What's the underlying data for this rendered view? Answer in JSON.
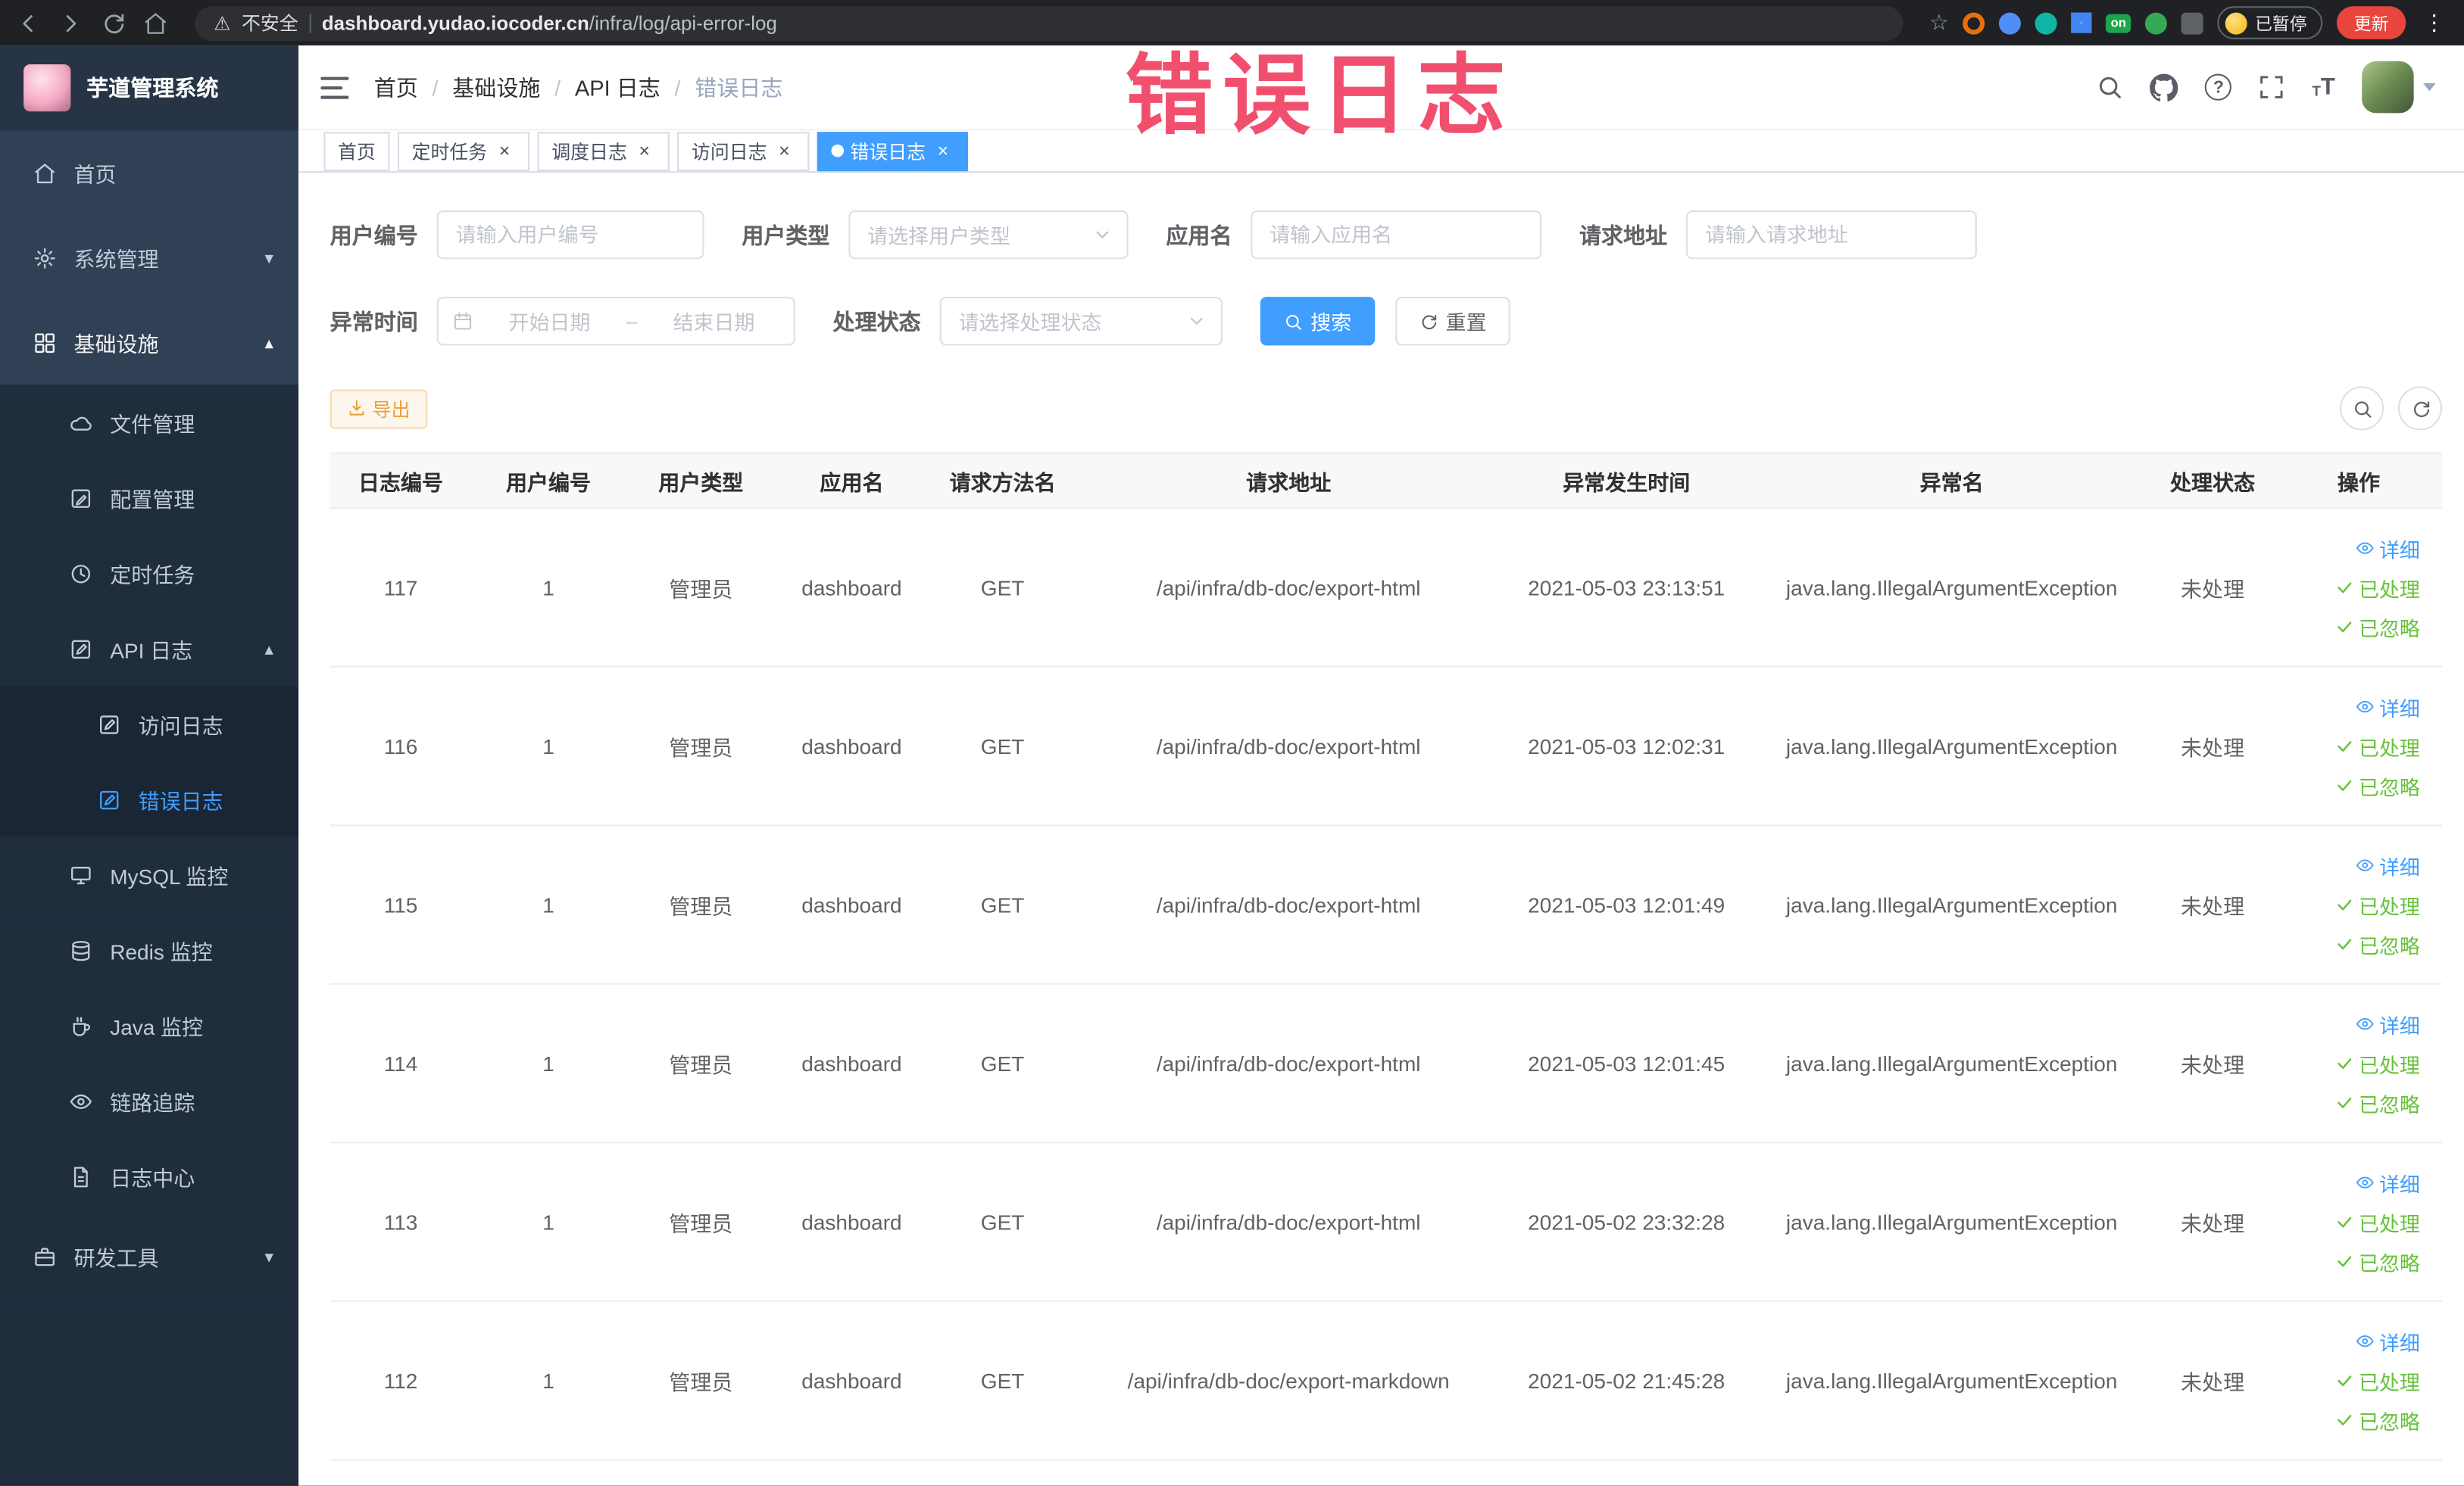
{
  "colors": {
    "accent": "#409EFF",
    "success": "#67C23A",
    "warning": "#E6A23C",
    "overlay": "#F0506E",
    "sidebar_bg": "#304156"
  },
  "overlay_text": "错误日志",
  "browser": {
    "security_label": "不安全",
    "url_domain": "dashboard.yudao.iocoder.cn",
    "url_path": "/infra/log/api-error-log",
    "ext_on_badge": "on",
    "paused_badge": "已暂停",
    "update_button": "更新"
  },
  "app": {
    "logo_title": "芋道管理系统"
  },
  "sidebar": {
    "items": [
      {
        "label": "首页",
        "level": 1,
        "icon": "home-icon"
      },
      {
        "label": "系统管理",
        "level": 1,
        "icon": "gear-icon",
        "arrow": "down"
      },
      {
        "label": "基础设施",
        "level": 1,
        "icon": "grid-icon",
        "arrow": "up",
        "expanded": true
      },
      {
        "label": "文件管理",
        "level": 2,
        "icon": "cloud-icon"
      },
      {
        "label": "配置管理",
        "level": 2,
        "icon": "edit-icon"
      },
      {
        "label": "定时任务",
        "level": 2,
        "icon": "clock-icon"
      },
      {
        "label": "API 日志",
        "level": 2,
        "icon": "log-icon",
        "arrow": "up",
        "expanded": true
      },
      {
        "label": "访问日志",
        "level": 3,
        "icon": "log-icon"
      },
      {
        "label": "错误日志",
        "level": 3,
        "icon": "log-icon",
        "active": true
      },
      {
        "label": "MySQL 监控",
        "level": 2,
        "icon": "monitor-icon"
      },
      {
        "label": "Redis 监控",
        "level": 2,
        "icon": "database-icon"
      },
      {
        "label": "Java 监控",
        "level": 2,
        "icon": "coffee-icon"
      },
      {
        "label": "链路追踪",
        "level": 2,
        "icon": "eye-icon"
      },
      {
        "label": "日志中心",
        "level": 2,
        "icon": "document-icon"
      },
      {
        "label": "研发工具",
        "level": 1,
        "icon": "briefcase-icon",
        "arrow": "down"
      }
    ]
  },
  "breadcrumb": [
    "首页",
    "基础设施",
    "API 日志",
    "错误日志"
  ],
  "tabs": [
    {
      "label": "首页",
      "closable": false,
      "active": false
    },
    {
      "label": "定时任务",
      "closable": true,
      "active": false
    },
    {
      "label": "调度日志",
      "closable": true,
      "active": false
    },
    {
      "label": "访问日志",
      "closable": true,
      "active": false
    },
    {
      "label": "错误日志",
      "closable": true,
      "active": true
    }
  ],
  "filters": {
    "user_id": {
      "label": "用户编号",
      "placeholder": "请输入用户编号"
    },
    "user_type": {
      "label": "用户类型",
      "placeholder": "请选择用户类型"
    },
    "app_name": {
      "label": "应用名",
      "placeholder": "请输入应用名"
    },
    "request_url": {
      "label": "请求地址",
      "placeholder": "请输入请求地址"
    },
    "exception_time": {
      "label": "异常时间",
      "start_placeholder": "开始日期",
      "separator": "–",
      "end_placeholder": "结束日期"
    },
    "process_status": {
      "label": "处理状态",
      "placeholder": "请选择处理状态"
    },
    "search_button": "搜索",
    "reset_button": "重置"
  },
  "toolbar": {
    "export_button": "导出"
  },
  "table": {
    "columns": [
      "日志编号",
      "用户编号",
      "用户类型",
      "应用名",
      "请求方法名",
      "请求地址",
      "异常发生时间",
      "异常名",
      "处理状态",
      "操作"
    ],
    "actions": {
      "detail": "详细",
      "processed": "已处理",
      "ignored": "已忽略"
    },
    "rows": [
      {
        "id": "117",
        "user_id": "1",
        "user_type": "管理员",
        "app": "dashboard",
        "method": "GET",
        "url": "/api/infra/db-doc/export-html",
        "time": "2021-05-03 23:13:51",
        "exception": "java.lang.IllegalArgumentException",
        "status": "未处理"
      },
      {
        "id": "116",
        "user_id": "1",
        "user_type": "管理员",
        "app": "dashboard",
        "method": "GET",
        "url": "/api/infra/db-doc/export-html",
        "time": "2021-05-03 12:02:31",
        "exception": "java.lang.IllegalArgumentException",
        "status": "未处理"
      },
      {
        "id": "115",
        "user_id": "1",
        "user_type": "管理员",
        "app": "dashboard",
        "method": "GET",
        "url": "/api/infra/db-doc/export-html",
        "time": "2021-05-03 12:01:49",
        "exception": "java.lang.IllegalArgumentException",
        "status": "未处理"
      },
      {
        "id": "114",
        "user_id": "1",
        "user_type": "管理员",
        "app": "dashboard",
        "method": "GET",
        "url": "/api/infra/db-doc/export-html",
        "time": "2021-05-03 12:01:45",
        "exception": "java.lang.IllegalArgumentException",
        "status": "未处理"
      },
      {
        "id": "113",
        "user_id": "1",
        "user_type": "管理员",
        "app": "dashboard",
        "method": "GET",
        "url": "/api/infra/db-doc/export-html",
        "time": "2021-05-02 23:32:28",
        "exception": "java.lang.IllegalArgumentException",
        "status": "未处理"
      },
      {
        "id": "112",
        "user_id": "1",
        "user_type": "管理员",
        "app": "dashboard",
        "method": "GET",
        "url": "/api/infra/db-doc/export-markdown",
        "time": "2021-05-02 21:45:28",
        "exception": "java.lang.IllegalArgumentException",
        "status": "未处理"
      }
    ]
  }
}
